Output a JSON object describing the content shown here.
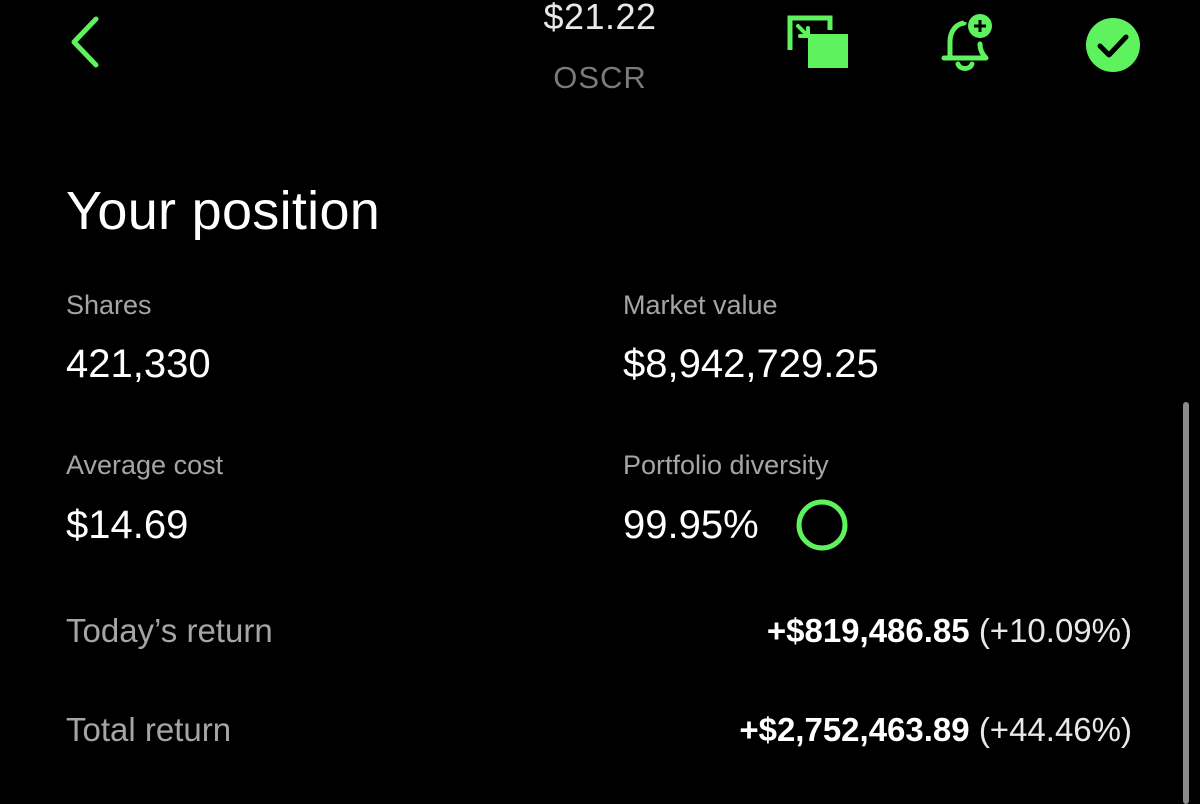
{
  "header": {
    "price": "$21.22",
    "ticker": "OSCR",
    "icons": [
      "back-chevron-icon",
      "picture-in-picture-icon",
      "add-alert-bell-icon",
      "watchlist-check-icon"
    ]
  },
  "position": {
    "title": "Your position",
    "shares_label": "Shares",
    "shares_value": "421,330",
    "market_value_label": "Market value",
    "market_value": "$8,942,729.25",
    "average_cost_label": "Average cost",
    "average_cost_value": "$14.69",
    "diversity_label": "Portfolio diversity",
    "diversity_value": "99.95%",
    "diversity_fraction": 0.9995,
    "todays_return_label": "Today’s return",
    "todays_return_amount": "+$819,486.85",
    "todays_return_percent": "(+10.09%)",
    "total_return_label": "Total return",
    "total_return_amount": "+$2,752,463.89",
    "total_return_percent": "(+44.46%)"
  },
  "colors": {
    "background": "#000000",
    "accent_green": "#5ef25e",
    "label_gray": "#a5a5a5",
    "ticker_gray": "#7a7a7a"
  }
}
